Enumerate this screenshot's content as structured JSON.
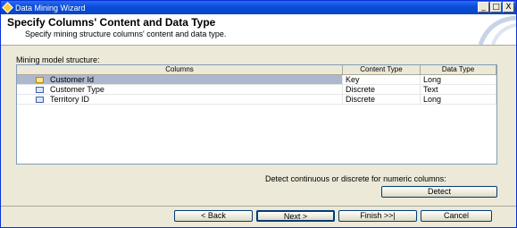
{
  "window": {
    "title": "Data Mining Wizard",
    "controls": {
      "minimize": "_",
      "maximize": "□",
      "close": "X"
    }
  },
  "header": {
    "title": "Specify Columns' Content and Data Type",
    "subtitle": "Specify mining structure columns' content and data type."
  },
  "grid": {
    "label": "Mining model structure:",
    "headers": [
      "Columns",
      "Content Type",
      "Data Type"
    ],
    "rows": [
      {
        "icon": "key-column-icon",
        "column": "Customer Id",
        "content": "Key",
        "type": "Long",
        "selected": true
      },
      {
        "icon": "column-icon",
        "column": "Customer Type",
        "content": "Discrete",
        "type": "Text",
        "selected": false
      },
      {
        "icon": "column-icon",
        "column": "Territory ID",
        "content": "Discrete",
        "type": "Long",
        "selected": false
      }
    ]
  },
  "detect": {
    "label": "Detect continuous or discrete for numeric columns:",
    "button": "Detect"
  },
  "footer": {
    "back": "< Back",
    "next": "Next >",
    "finish": "Finish >>|",
    "cancel": "Cancel"
  },
  "colors": {
    "titlebar": "#0a4cd8",
    "selection": "#adb7cf",
    "face": "#ece9d8"
  }
}
